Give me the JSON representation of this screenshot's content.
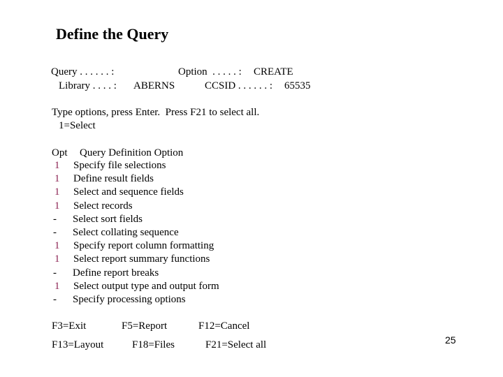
{
  "title": "Define the Query",
  "header": {
    "query_label": "Query . . . . . . :",
    "query_value": "",
    "option_label": "Option  . . . . . :",
    "option_value": "CREATE",
    "library_label": "Library . . . . :",
    "library_value": "ABERNS",
    "ccsid_label": "CCSID . . . . . . :",
    "ccsid_value": "65535"
  },
  "instructions": {
    "line1": "Type options, press Enter.  Press F21 to select all.",
    "line2": "1=Select"
  },
  "table": {
    "col_opt": "Opt",
    "col_option": "Query Definition Option",
    "rows": [
      {
        "opt": "1",
        "label": "Specify file selections"
      },
      {
        "opt": "1",
        "label": "Define result fields"
      },
      {
        "opt": "1",
        "label": "Select and sequence fields"
      },
      {
        "opt": "1",
        "label": "Select records"
      },
      {
        "opt": "-",
        "label": "Select sort fields"
      },
      {
        "opt": "-",
        "label": "Select collating sequence"
      },
      {
        "opt": "1",
        "label": "Specify report column formatting"
      },
      {
        "opt": "1",
        "label": "Select report summary functions"
      },
      {
        "opt": "-",
        "label": "Define report breaks"
      },
      {
        "opt": "1",
        "label": "Select output type and output form"
      },
      {
        "opt": "-",
        "label": "Specify processing options"
      }
    ]
  },
  "function_keys": {
    "f3": "F3=Exit",
    "f5": "F5=Report",
    "f12": "F12=Cancel",
    "f13": "F13=Layout",
    "f18": "F18=Files",
    "f21": "F21=Select all"
  },
  "page_number": "25",
  "colors": {
    "selected_option": "#8b2252"
  }
}
